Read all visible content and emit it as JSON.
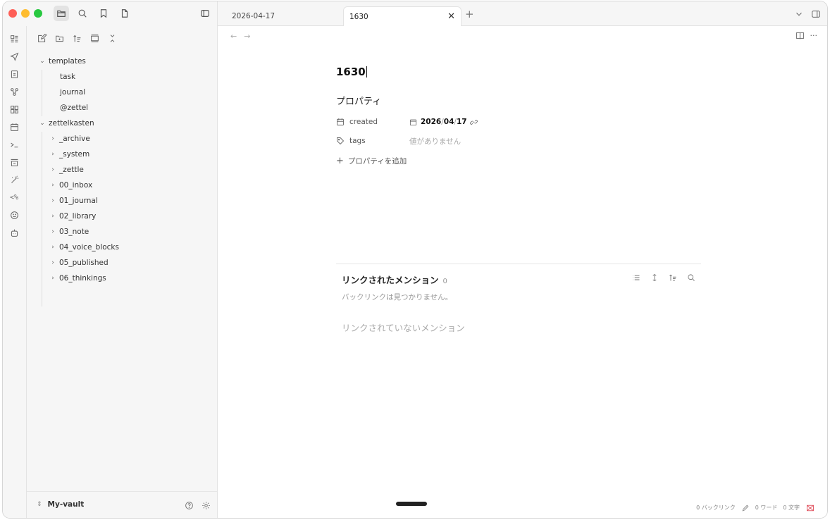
{
  "tabs": [
    {
      "label": "2026-04-17",
      "active": false
    },
    {
      "label": "1630",
      "active": true
    }
  ],
  "sidebar": {
    "tree": [
      {
        "label": "templates",
        "level": 0,
        "expanded": true
      },
      {
        "label": "task",
        "level": 1
      },
      {
        "label": "journal",
        "level": 1
      },
      {
        "label": "@zettel",
        "level": 1
      },
      {
        "label": "zettelkasten",
        "level": 0,
        "expanded": true
      },
      {
        "label": "_archive",
        "level": 1,
        "expanded": false
      },
      {
        "label": "_system",
        "level": 1,
        "expanded": false
      },
      {
        "label": "_zettle",
        "level": 1,
        "expanded": false
      },
      {
        "label": "00_inbox",
        "level": 1,
        "expanded": false
      },
      {
        "label": "01_journal",
        "level": 1,
        "expanded": false
      },
      {
        "label": "02_library",
        "level": 1,
        "expanded": false
      },
      {
        "label": "03_note",
        "level": 1,
        "expanded": false
      },
      {
        "label": "04_voice_blocks",
        "level": 1,
        "expanded": false
      },
      {
        "label": "05_published",
        "level": 1,
        "expanded": false
      },
      {
        "label": "06_thinkings",
        "level": 1,
        "expanded": false
      }
    ],
    "vault_name": "My-vault"
  },
  "ribbon": {
    "template_icon_text": "<%"
  },
  "note": {
    "title": "1630",
    "properties_heading": "プロパティ",
    "properties": [
      {
        "key": "created",
        "icon": "calendar-icon",
        "value": "2026/04/17",
        "date_parts": [
          "2026",
          "04",
          "17"
        ]
      },
      {
        "key": "tags",
        "icon": "tag-icon",
        "value": "値がありません",
        "empty": true
      }
    ],
    "add_property_label": "プロパティを追加"
  },
  "backlinks": {
    "heading": "リンクされたメンション",
    "count": "0",
    "empty_message": "バックリンクは見つかりません。",
    "unlinked_heading": "リンクされていないメンション"
  },
  "status_bar": {
    "backlinks": "0 バックリンク",
    "words": "0 ワード",
    "chars": "0 文字"
  },
  "colors": {
    "traffic_red": "#fe5f57",
    "traffic_yellow": "#febc2e",
    "traffic_green": "#28c840",
    "sync_error": "#e0525f"
  }
}
